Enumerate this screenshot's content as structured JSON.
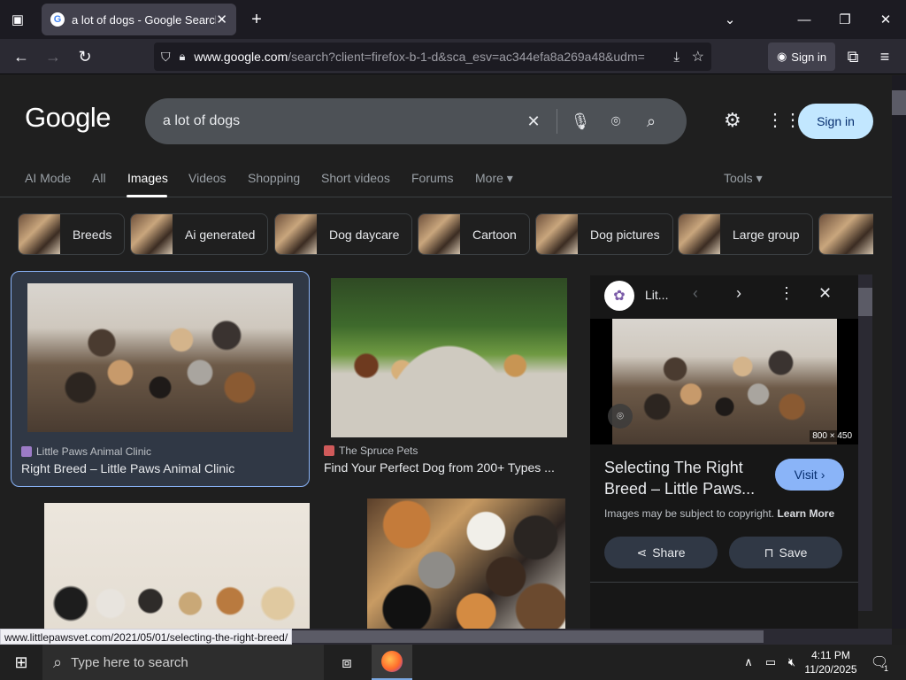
{
  "browser": {
    "tab_title": "a lot of dogs - Google Search",
    "url_domain": "www.google.com",
    "url_rest": "/search?client=firefox-b-1-d&sca_esv=ac344efa8a269a48&udm=",
    "signin_label": "Sign in"
  },
  "google": {
    "logo": "Google",
    "query": "a lot of dogs",
    "signin_label": "Sign in",
    "tabs": [
      "AI Mode",
      "All",
      "Images",
      "Videos",
      "Shopping",
      "Short videos",
      "Forums",
      "More ▾"
    ],
    "tools_label": "Tools ▾"
  },
  "chips": [
    "Breeds",
    "Ai generated",
    "Dog daycare",
    "Cartoon",
    "Dog pictures",
    "Large group"
  ],
  "results": [
    {
      "source": "Little Paws Animal Clinic",
      "title": "Right Breed – Little Paws Animal Clinic"
    },
    {
      "source": "The Spruce Pets",
      "title": "Find Your Perfect Dog from 200+ Types ..."
    }
  ],
  "panel": {
    "site_short": "Lit...",
    "dimensions": "800 × 450",
    "title": "Selecting The Right Breed – Little Paws...",
    "visit_label": "Visit ›",
    "copyright": "Images may be subject to copyright. ",
    "learn_more": "Learn More",
    "share_label": "Share",
    "save_label": "Save"
  },
  "status_url": "www.littlepawsvet.com/2021/05/01/selecting-the-right-breed/",
  "taskbar": {
    "search_placeholder": "Type here to search",
    "time": "4:11 PM",
    "date": "11/20/2025",
    "notif_count": "1"
  }
}
